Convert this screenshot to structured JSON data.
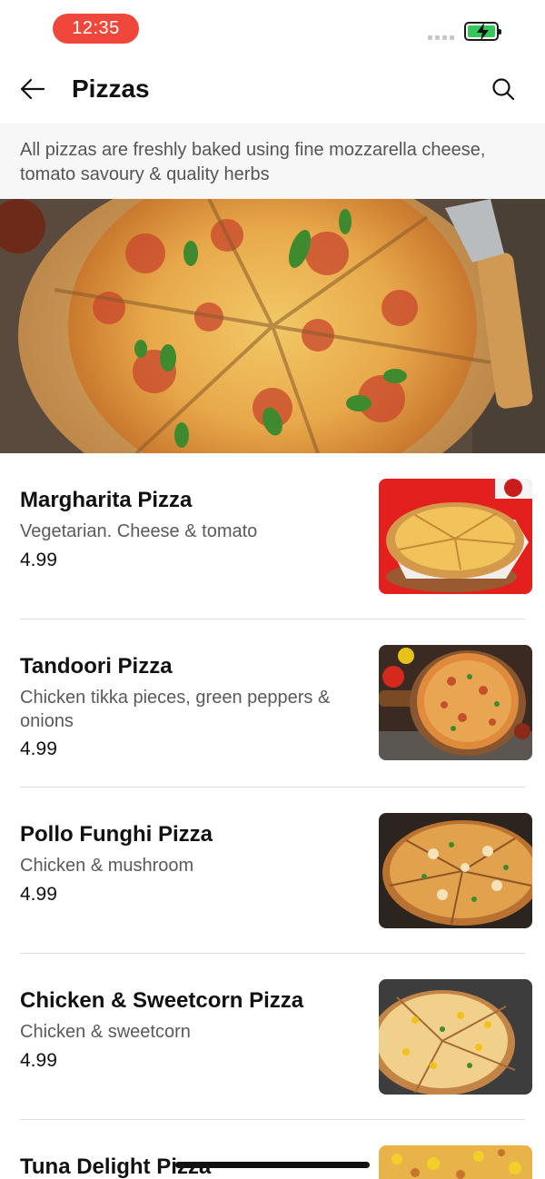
{
  "status_bar": {
    "time": "12:35",
    "battery_color": "#34c759",
    "time_pill_color": "#f0473d"
  },
  "header": {
    "title": "Pizzas",
    "back_icon": "arrow-left-icon",
    "search_icon": "search-icon"
  },
  "intro": {
    "text": "All pizzas are freshly baked using fine mozzarella cheese, tomato savoury & quality herbs"
  },
  "items": [
    {
      "name": "Margharita Pizza",
      "description": "Vegetarian. Cheese & tomato",
      "price": "4.99"
    },
    {
      "name": "Tandoori Pizza",
      "description": "Chicken tikka pieces, green peppers & onions",
      "price": "4.99"
    },
    {
      "name": "Pollo Funghi Pizza",
      "description": "Chicken & mushroom",
      "price": "4.99"
    },
    {
      "name": "Chicken & Sweetcorn Pizza",
      "description": "Chicken & sweetcorn",
      "price": "4.99"
    },
    {
      "name": "Tuna Delight Pizza"
    }
  ]
}
